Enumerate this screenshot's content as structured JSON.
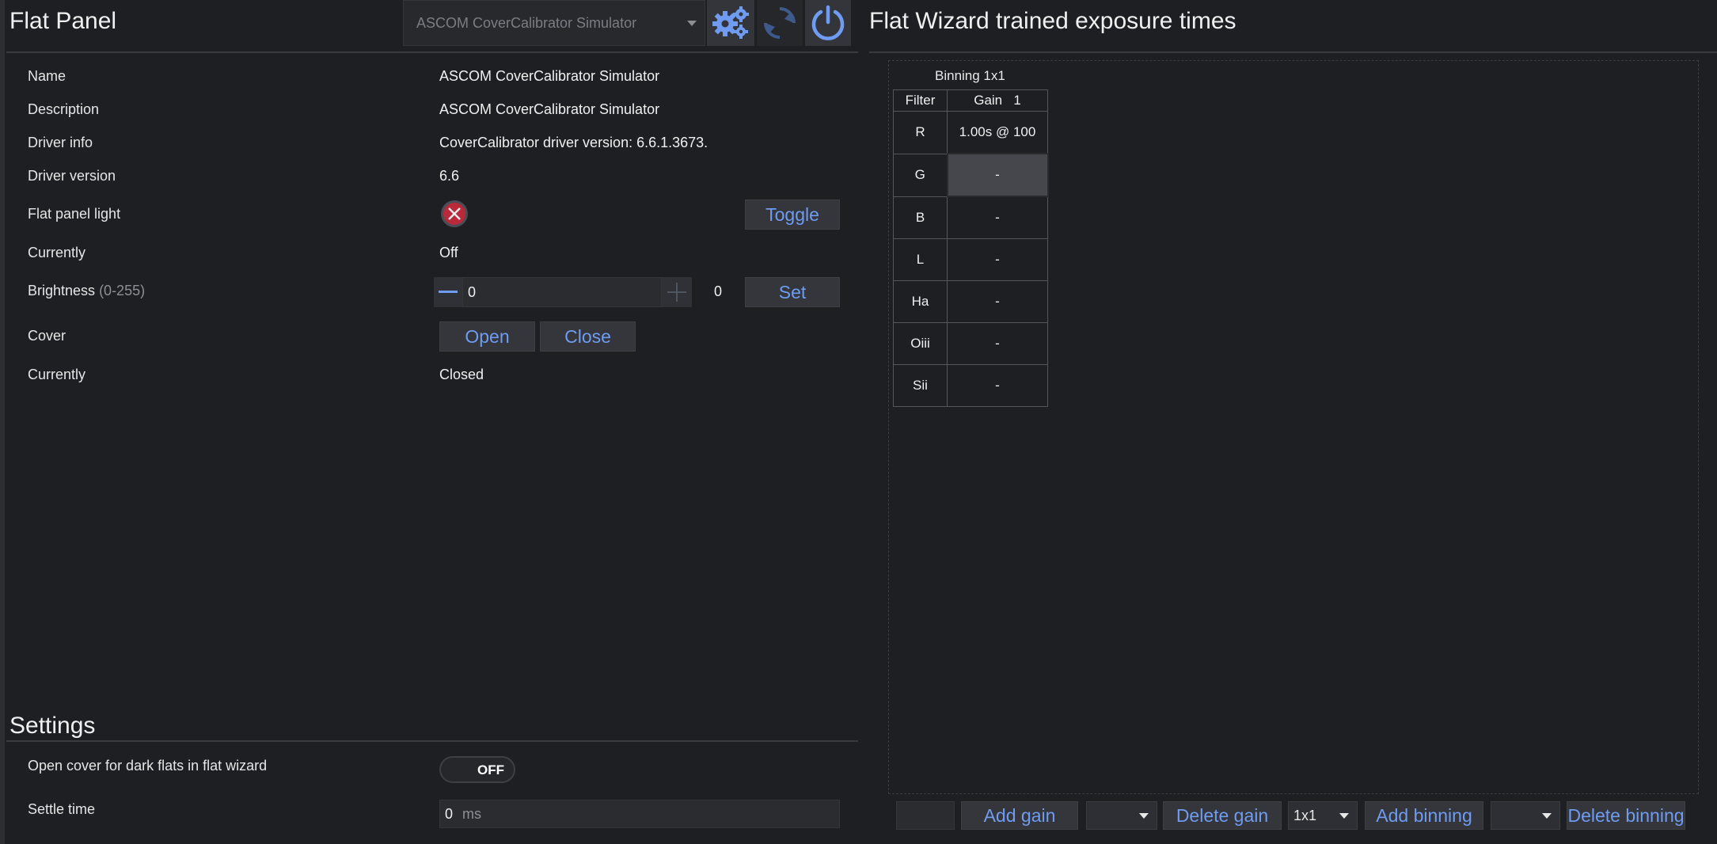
{
  "left": {
    "title": "Flat Panel",
    "device_combo": "ASCOM CoverCalibrator Simulator",
    "rows": {
      "name": {
        "label": "Name",
        "value": "ASCOM CoverCalibrator Simulator"
      },
      "description": {
        "label": "Description",
        "value": "ASCOM CoverCalibrator Simulator"
      },
      "driver_info": {
        "label": "Driver info",
        "value": "CoverCalibrator driver version: 6.6.1.3673."
      },
      "driver_version": {
        "label": "Driver version",
        "value": "6.6"
      },
      "flat_panel_light": {
        "label": "Flat panel light",
        "button": "Toggle"
      },
      "currently_light": {
        "label": "Currently",
        "value": "Off"
      },
      "brightness": {
        "label": "Brightness",
        "hint": "(0-255)",
        "input": "0",
        "current": "0",
        "button": "Set"
      },
      "cover": {
        "label": "Cover",
        "open": "Open",
        "close": "Close"
      },
      "currently_cover": {
        "label": "Currently",
        "value": "Closed"
      }
    },
    "settings": {
      "title": "Settings",
      "open_cover_label": "Open cover for dark flats in flat wizard",
      "open_cover_toggle": "OFF",
      "settle_label": "Settle time",
      "settle_value": "0",
      "settle_unit": "ms"
    }
  },
  "right": {
    "title": "Flat Wizard trained exposure times",
    "binning_caption": "Binning 1x1",
    "headers": {
      "filter": "Filter",
      "gain": "Gain",
      "gain_value": "1"
    },
    "rows": [
      {
        "filter": "R",
        "value": "1.00s @ 100"
      },
      {
        "filter": "G",
        "value": "-"
      },
      {
        "filter": "B",
        "value": "-"
      },
      {
        "filter": "L",
        "value": "-"
      },
      {
        "filter": "Ha",
        "value": "-"
      },
      {
        "filter": "Oiii",
        "value": "-"
      },
      {
        "filter": "Sii",
        "value": "-"
      }
    ],
    "bottom": {
      "add_gain": "Add gain",
      "delete_gain": "Delete gain",
      "binning_select": "1x1",
      "add_binning": "Add binning",
      "delete_binning": "Delete binning"
    }
  },
  "icons": {
    "settings": "gear-icon",
    "refresh": "refresh-icon",
    "power": "power-icon",
    "light_state": "x-circle-icon",
    "minus": "minus-icon",
    "plus": "plus-icon"
  },
  "colors": {
    "background": "#1e1f22",
    "accent": "#6f9cf0",
    "button_bg": "#34363c",
    "error_red": "#c42b3a"
  }
}
